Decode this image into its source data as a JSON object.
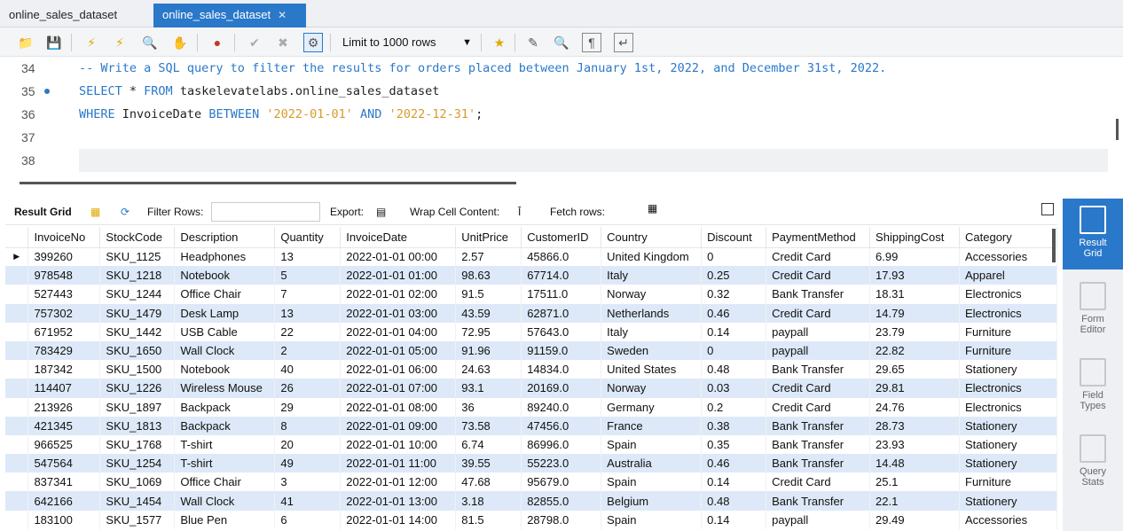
{
  "tabs": [
    {
      "label": "online_sales_dataset",
      "active": false
    },
    {
      "label": "online_sales_dataset",
      "active": true
    }
  ],
  "toolbar": {
    "limit_label": "Limit to 1000 rows"
  },
  "editor": {
    "lines": [
      {
        "num": "34",
        "text": "-- Write a SQL query to filter the results for orders placed between January 1st, 2022, and December 31st, 2022."
      },
      {
        "num": "35",
        "kw1": "SELECT",
        "mid1": " * ",
        "kw2": "FROM",
        "rest": " taskelevatelabs.online_sales_dataset"
      },
      {
        "num": "36",
        "kw1": "WHERE",
        "mid1": " InvoiceDate ",
        "kw2": "BETWEEN",
        "s1": "'2022-01-01'",
        "kw3": "AND",
        "s2": "'2022-12-31'",
        "end": ";"
      },
      {
        "num": "37"
      },
      {
        "num": "38"
      }
    ]
  },
  "result_toolbar": {
    "result_grid": "Result Grid",
    "filter_rows": "Filter Rows:",
    "export": "Export:",
    "wrap": "Wrap Cell Content:",
    "fetch": "Fetch rows:"
  },
  "grid": {
    "columns": [
      "InvoiceNo",
      "StockCode",
      "Description",
      "Quantity",
      "InvoiceDate",
      "UnitPrice",
      "CustomerID",
      "Country",
      "Discount",
      "PaymentMethod",
      "ShippingCost",
      "Category"
    ],
    "rows": [
      [
        "399260",
        "SKU_1125",
        "Headphones",
        "13",
        "2022-01-01 00:00",
        "2.57",
        "45866.0",
        "United Kingdom",
        "0",
        "Credit Card",
        "6.99",
        "Accessories"
      ],
      [
        "978548",
        "SKU_1218",
        "Notebook",
        "5",
        "2022-01-01 01:00",
        "98.63",
        "67714.0",
        "Italy",
        "0.25",
        "Credit Card",
        "17.93",
        "Apparel"
      ],
      [
        "527443",
        "SKU_1244",
        "Office Chair",
        "7",
        "2022-01-01 02:00",
        "91.5",
        "17511.0",
        "Norway",
        "0.32",
        "Bank Transfer",
        "18.31",
        "Electronics"
      ],
      [
        "757302",
        "SKU_1479",
        "Desk Lamp",
        "13",
        "2022-01-01 03:00",
        "43.59",
        "62871.0",
        "Netherlands",
        "0.46",
        "Credit Card",
        "14.79",
        "Electronics"
      ],
      [
        "671952",
        "SKU_1442",
        "USB Cable",
        "22",
        "2022-01-01 04:00",
        "72.95",
        "57643.0",
        "Italy",
        "0.14",
        "paypall",
        "23.79",
        "Furniture"
      ],
      [
        "783429",
        "SKU_1650",
        "Wall Clock",
        "2",
        "2022-01-01 05:00",
        "91.96",
        "91159.0",
        "Sweden",
        "0",
        "paypall",
        "22.82",
        "Furniture"
      ],
      [
        "187342",
        "SKU_1500",
        "Notebook",
        "40",
        "2022-01-01 06:00",
        "24.63",
        "14834.0",
        "United States",
        "0.48",
        "Bank Transfer",
        "29.65",
        "Stationery"
      ],
      [
        "114407",
        "SKU_1226",
        "Wireless Mouse",
        "26",
        "2022-01-01 07:00",
        "93.1",
        "20169.0",
        "Norway",
        "0.03",
        "Credit Card",
        "29.81",
        "Electronics"
      ],
      [
        "213926",
        "SKU_1897",
        "Backpack",
        "29",
        "2022-01-01 08:00",
        "36",
        "89240.0",
        "Germany",
        "0.2",
        "Credit Card",
        "24.76",
        "Electronics"
      ],
      [
        "421345",
        "SKU_1813",
        "Backpack",
        "8",
        "2022-01-01 09:00",
        "73.58",
        "47456.0",
        "France",
        "0.38",
        "Bank Transfer",
        "28.73",
        "Stationery"
      ],
      [
        "966525",
        "SKU_1768",
        "T-shirt",
        "20",
        "2022-01-01 10:00",
        "6.74",
        "86996.0",
        "Spain",
        "0.35",
        "Bank Transfer",
        "23.93",
        "Stationery"
      ],
      [
        "547564",
        "SKU_1254",
        "T-shirt",
        "49",
        "2022-01-01 11:00",
        "39.55",
        "55223.0",
        "Australia",
        "0.46",
        "Bank Transfer",
        "14.48",
        "Stationery"
      ],
      [
        "837341",
        "SKU_1069",
        "Office Chair",
        "3",
        "2022-01-01 12:00",
        "47.68",
        "95679.0",
        "Spain",
        "0.14",
        "Credit Card",
        "25.1",
        "Furniture"
      ],
      [
        "642166",
        "SKU_1454",
        "Wall Clock",
        "41",
        "2022-01-01 13:00",
        "3.18",
        "82855.0",
        "Belgium",
        "0.48",
        "Bank Transfer",
        "22.1",
        "Stationery"
      ],
      [
        "183100",
        "SKU_1577",
        "Blue Pen",
        "6",
        "2022-01-01 14:00",
        "81.5",
        "28798.0",
        "Spain",
        "0.14",
        "paypall",
        "29.49",
        "Accessories"
      ]
    ]
  },
  "side_panel": {
    "result_grid_1": "Result",
    "result_grid_2": "Grid",
    "form_editor_1": "Form",
    "form_editor_2": "Editor",
    "field_types_1": "Field",
    "field_types_2": "Types",
    "query_stats_1": "Query",
    "query_stats_2": "Stats"
  }
}
